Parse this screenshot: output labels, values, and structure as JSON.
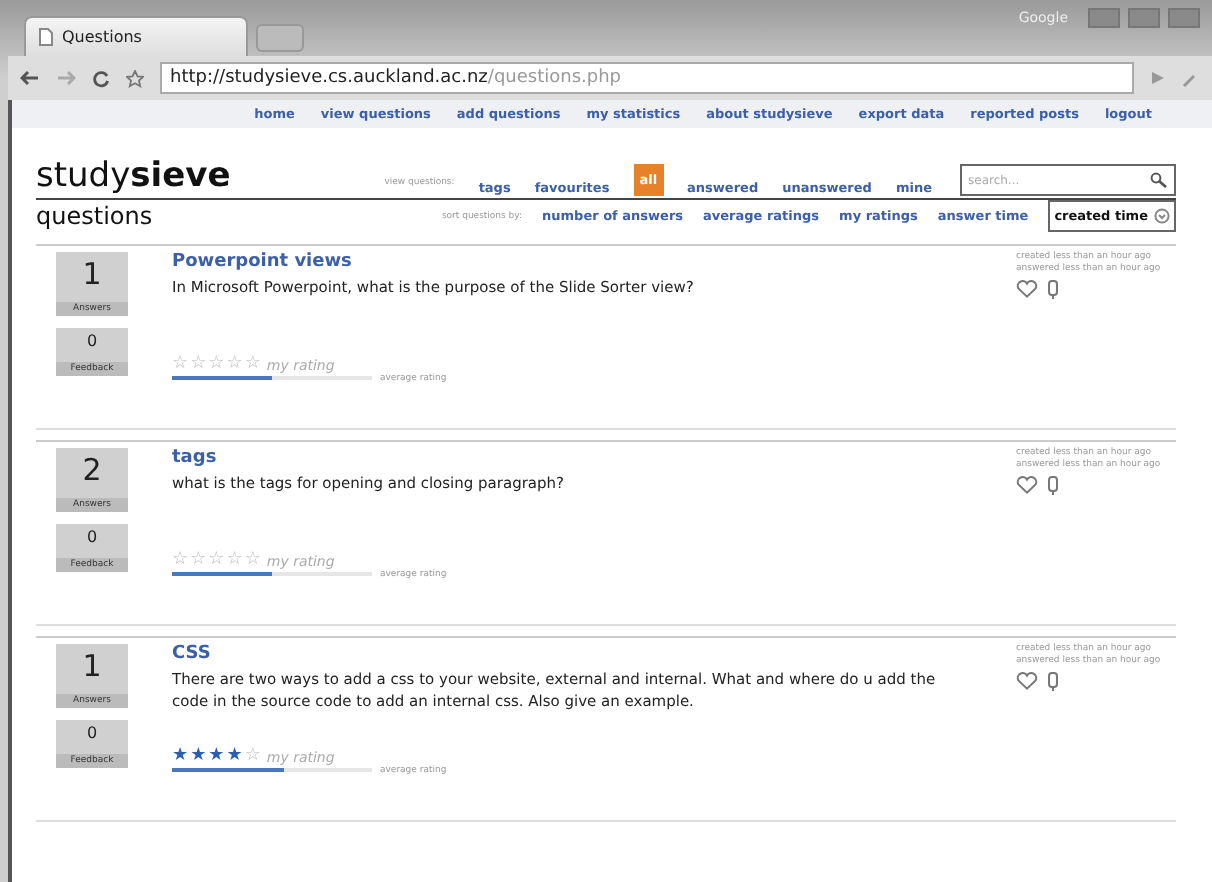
{
  "browser": {
    "corner_text": "Google",
    "tab": {
      "title": "Questions"
    },
    "address": {
      "host": "http://studysieve.cs.auckland.ac.nz",
      "path": "/questions.php"
    }
  },
  "nav": [
    "home",
    "view questions",
    "add questions",
    "my statistics",
    "about studysieve",
    "export data",
    "reported posts",
    "logout"
  ],
  "logo": {
    "light": "study",
    "bold": "sieve"
  },
  "page_title": "questions",
  "view_label": "view questions:",
  "view_filters": [
    {
      "label": "tags",
      "selected": false
    },
    {
      "label": "favourites",
      "selected": false
    },
    {
      "label": "all",
      "selected": true
    },
    {
      "label": "answered",
      "selected": false
    },
    {
      "label": "unanswered",
      "selected": false
    },
    {
      "label": "mine",
      "selected": false
    }
  ],
  "search": {
    "placeholder": "search..."
  },
  "sort_label": "sort questions by:",
  "sort_options": [
    {
      "label": "number of answers",
      "selected": false
    },
    {
      "label": "average ratings",
      "selected": false
    },
    {
      "label": "my ratings",
      "selected": false
    },
    {
      "label": "answer time",
      "selected": false
    },
    {
      "label": "created time",
      "selected": true
    }
  ],
  "questions": [
    {
      "answers": "1",
      "answers_label": "Answers",
      "feedback": "0",
      "feedback_label": "Feedback",
      "title": "Powerpoint views",
      "text": "In Microsoft Powerpoint, what is the purpose of the Slide Sorter view?",
      "stars": 0,
      "my_rating": "my rating",
      "average": {
        "level": 0.5,
        "label": "average rating"
      },
      "created": "created less than an hour ago",
      "answered": "answered less than an hour ago"
    },
    {
      "answers": "2",
      "answers_label": "Answers",
      "feedback": "0",
      "feedback_label": "Feedback",
      "title": "tags",
      "text": "what is the tags for opening and closing paragraph?",
      "stars": 0,
      "my_rating": "my rating",
      "average": {
        "level": 0.5,
        "label": "average rating"
      },
      "created": "created less than an hour ago",
      "answered": "answered less than an hour ago"
    },
    {
      "answers": "1",
      "answers_label": "Answers",
      "feedback": "0",
      "feedback_label": "Feedback",
      "title": "CSS",
      "text": "There are two ways to add a css to your website, external and internal. What and where do u add the code in the source code to add an internal css. Also give an example.",
      "stars": 4,
      "my_rating": "my rating",
      "average": {
        "level": 0.56,
        "label": "average rating"
      },
      "created": "created less than an hour ago",
      "answered": "answered less than an hour ago"
    }
  ]
}
